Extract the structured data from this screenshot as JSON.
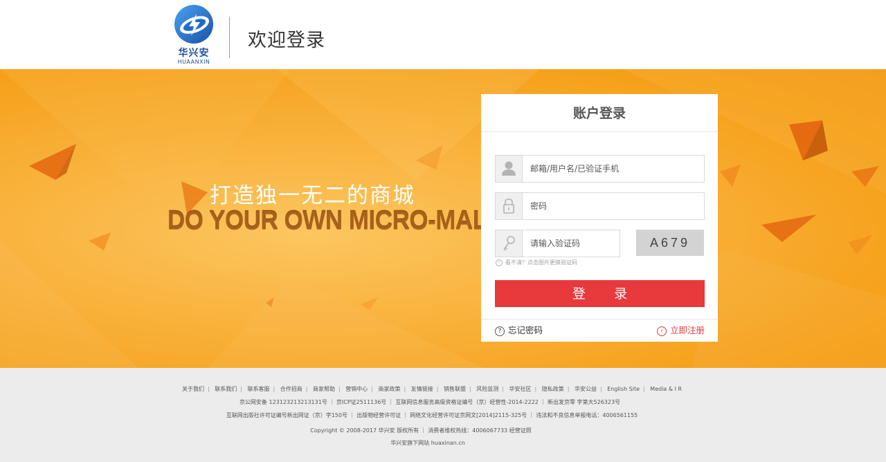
{
  "header": {
    "logo_cn": "华兴安",
    "logo_en": "HUAANXIN",
    "title": "欢迎登录"
  },
  "banner": {
    "slogan_cn": "打造独一无二的商城",
    "slogan_en": "DO YOUR OWN MICRO-MALL"
  },
  "login": {
    "title": "账户登录",
    "username_placeholder": "邮箱/用户名/已验证手机",
    "password_placeholder": "密码",
    "captcha_placeholder": "请输入验证码",
    "captcha_code": "A679",
    "captcha_hint": "看不清？点击图片更换验证码",
    "submit_label": "登 录",
    "forgot_label": "忘记密码",
    "register_label": "立即注册",
    "accent_color": "#e8393d"
  },
  "footer": {
    "links": [
      "关于我们",
      "联系我们",
      "联系客服",
      "合作招商",
      "商家帮助",
      "营销中心",
      "商家政策",
      "友情链接",
      "销售联盟",
      "风险监测",
      "华安社区",
      "隐私政策",
      "华安公益",
      "English Site",
      "Media & I R"
    ],
    "line2": "京公网安备 123123213213131号 ｜ 京ICP证2511136号 ｜ 互联网信息服务高级资格证编号（京）经营性-2014-2222 ｜ 新出发京零 字第大526323号",
    "line3": "互联网出版社许可证编号新出网证（京）字150号 ｜ 出版物经营许可证 ｜ 网络文化经营许可证京网文[2014]2115-325号 ｜ 违法和不良信息举报电话：4006561155",
    "line4": "Copyright © 2008-2017 华兴安 版权所有 ｜ 消费者维权热线：4006067733 经营证照",
    "line5": "华兴安旗下网站 huaxinan.cn"
  }
}
